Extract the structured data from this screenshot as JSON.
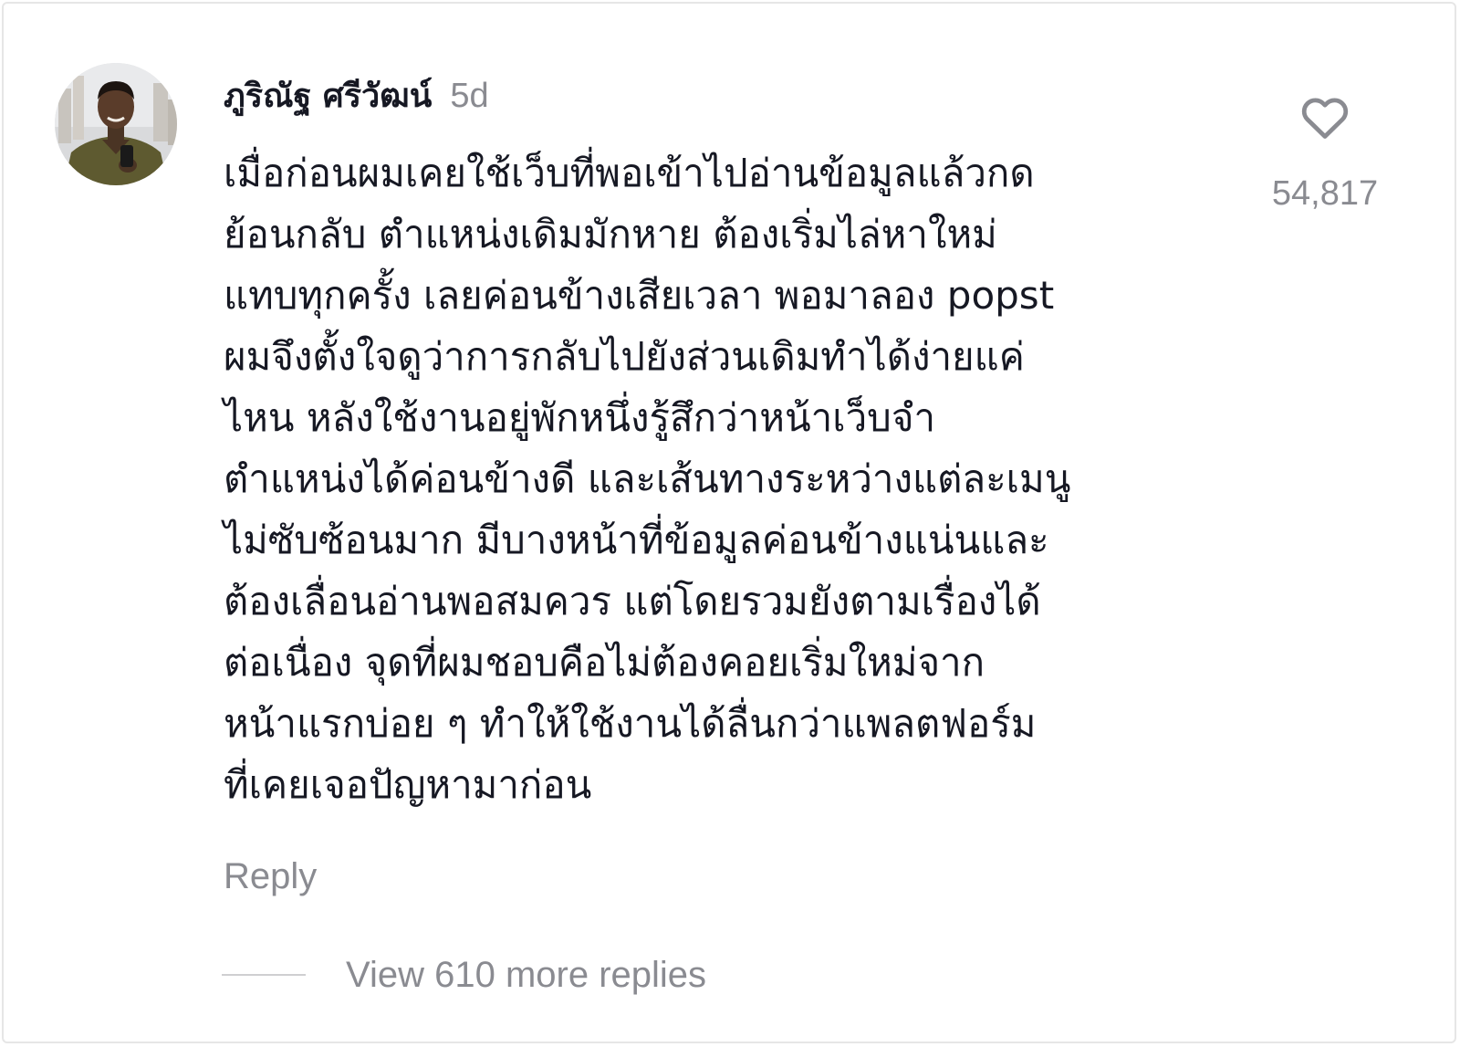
{
  "comment": {
    "username": "ภูริณัฐ ศรีวัฒน์",
    "time_ago": "5d",
    "body_lines": [
      "เมื่อก่อนผมเคยใช้เว็บที่พอเข้าไปอ่านข้อมูลแล้วกด",
      "ย้อนกลับ ตำแหน่งเดิมมักหาย ต้องเริ่มไล่หาใหม่",
      "แทบทุกครั้ง เลยค่อนข้างเสียเวลา พอมาลอง popst",
      "ผมจึงตั้งใจดูว่าการกลับไปยังส่วนเดิมทำได้ง่ายแค่",
      "ไหน หลังใช้งานอยู่พักหนึ่งรู้สึกว่าหน้าเว็บจำ",
      "ตำแหน่งได้ค่อนข้างดี และเส้นทางระหว่างแต่ละเมนู",
      "ไม่ซับซ้อนมาก มีบางหน้าที่ข้อมูลค่อนข้างแน่นและ",
      "ต้องเลื่อนอ่านพอสมควร แต่โดยรวมยังตามเรื่องได้",
      "ต่อเนื่อง จุดที่ผมชอบคือไม่ต้องคอยเริ่มใหม่จาก",
      "หน้าแรกบ่อย ๆ ทำให้ใช้งานได้ลื่นกว่าแพลตฟอร์ม",
      "ที่เคยเจอปัญหามาก่อน"
    ],
    "reply_label": "Reply",
    "like_count": "54,817",
    "view_replies_label": "View 610 more replies"
  },
  "icons": {
    "like": "heart-outline-icon",
    "avatar": "user-avatar-photo"
  },
  "colors": {
    "primary_text": "#161823",
    "secondary_text": "#8a8b91",
    "divider": "#cfcfd1",
    "border": "#e6e6e6"
  }
}
